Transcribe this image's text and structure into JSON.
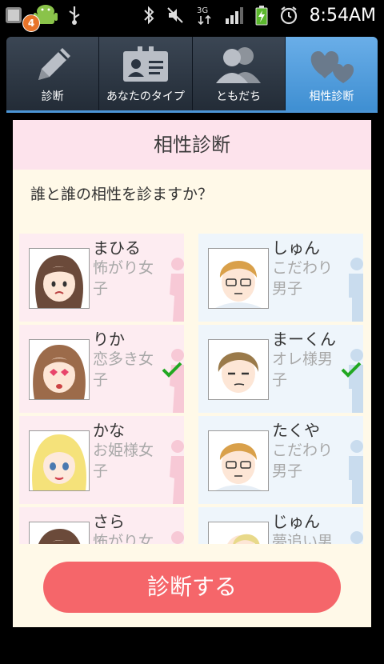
{
  "status_bar": {
    "notification_count": "4",
    "time": "8:54AM",
    "network": "3G"
  },
  "tabs": [
    {
      "label": "診断",
      "icon": "pencil-icon",
      "active": false
    },
    {
      "label": "あなたのタイプ",
      "icon": "id-card-icon",
      "active": false
    },
    {
      "label": "ともだち",
      "icon": "friends-icon",
      "active": false
    },
    {
      "label": "相性診断",
      "icon": "hearts-icon",
      "active": true
    }
  ],
  "panel": {
    "title": "相性診断",
    "question": "誰と誰の相性を診ますか？"
  },
  "people": {
    "female": [
      {
        "name": "まひる",
        "type": "怖がり女子",
        "checked": false
      },
      {
        "name": "りか",
        "type": "恋多き女子",
        "checked": true
      },
      {
        "name": "かな",
        "type": "お姫様女子",
        "checked": false
      },
      {
        "name": "さら",
        "type": "怖がり女",
        "checked": false
      }
    ],
    "male": [
      {
        "name": "しゅん",
        "type": "こだわり男子",
        "checked": false
      },
      {
        "name": "まーくん",
        "type": "オレ様男子",
        "checked": true
      },
      {
        "name": "たくや",
        "type": "こだわり男子",
        "checked": false
      },
      {
        "name": "じゅん",
        "type": "夢追い男",
        "checked": false
      }
    ]
  },
  "actions": {
    "diagnose_label": "診断する"
  },
  "colors": {
    "accent_blue": "#4b95d6",
    "button": "#f5666a",
    "female_card": "#fdecf1",
    "male_card": "#eef5fb",
    "check": "#22a822"
  }
}
